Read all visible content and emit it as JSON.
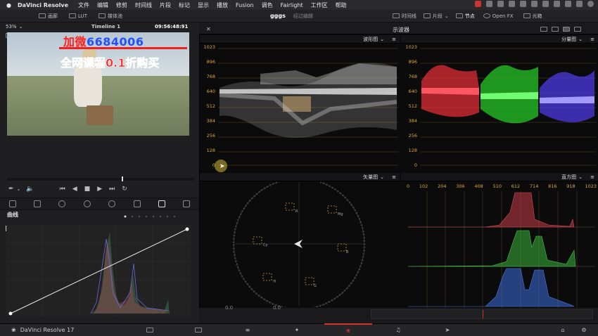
{
  "menubar": {
    "app_name": "DaVinci Resolve",
    "items": [
      "文件",
      "编辑",
      "修剪",
      "时间线",
      "片段",
      "标记",
      "显示",
      "播放",
      "Fusion",
      "调色",
      "Fairlight",
      "工作区",
      "帮助"
    ]
  },
  "toolbar": {
    "gallery": "画廊",
    "lut": "LUT",
    "media_pool": "媒体池",
    "project_name": "gggs",
    "edit_status": "经过编辑",
    "timeline": "时间线",
    "clips": "片段",
    "nodes": "节点",
    "open_fx": "Open FX",
    "lightbox": "光箱"
  },
  "viewer": {
    "zoom": "53%",
    "timeline_name": "Timeline 1",
    "timecode": "09:56:48:91",
    "overlay_top_red": "加微",
    "overlay_top_blue": "6684006",
    "overlay_bottom": "全网课程0.1折购买"
  },
  "curves": {
    "title": "曲线"
  },
  "scopes": {
    "title": "示波器",
    "waveform_label": "波形图",
    "parade_label": "分量图",
    "vectorscope_label": "矢量图",
    "histogram_label": "直方图",
    "y_ticks": [
      "1023",
      "896",
      "768",
      "640",
      "512",
      "384",
      "256",
      "128",
      "0"
    ],
    "hist_x_ticks": [
      "0",
      "102",
      "204",
      "306",
      "408",
      "510",
      "612",
      "714",
      "816",
      "918",
      "1023"
    ],
    "vector_targets": [
      "R",
      "Mg",
      "B",
      "Cy",
      "G",
      "Yl"
    ]
  },
  "bottom": {
    "app_label": "DaVinci Resolve 17",
    "lower_values": [
      "0.0",
      "0.0"
    ]
  },
  "colors": {
    "accent_orange": "#e0a63a",
    "active_tab": "#d9302c",
    "overlay_red": "#ff2020",
    "overlay_blue": "#2050ff"
  }
}
